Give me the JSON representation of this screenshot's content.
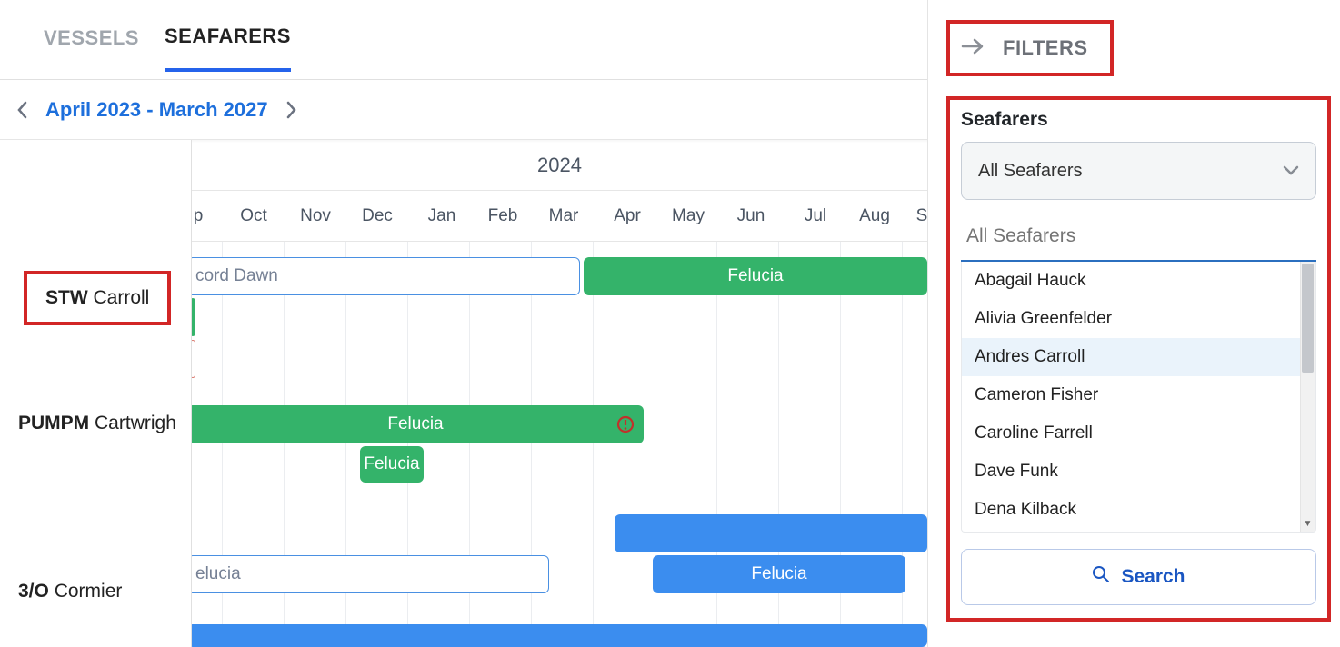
{
  "tabs": {
    "vessels": "VESSELS",
    "seafarers": "SEAFARERS"
  },
  "dateRange": "April 2023 - March 2027",
  "yearLabel": "2024",
  "months": [
    "p",
    "Oct",
    "Nov",
    "Dec",
    "Jan",
    "Feb",
    "Mar",
    "Apr",
    "May",
    "Jun",
    "Jul",
    "Aug",
    "S"
  ],
  "rows": {
    "carroll": {
      "rank": "STW",
      "name": "Carroll"
    },
    "cartwright": {
      "rank": "PUMPM",
      "name": "Cartwrigh"
    },
    "cormier": {
      "rank": "3/O",
      "name": "Cormier"
    }
  },
  "bars": {
    "carroll_cord": "cord Dawn",
    "carroll_felucia": "Felucia",
    "cart_felucia": "Felucia",
    "cart_felucia_chip": "Felucia",
    "cormier_white": "elucia",
    "cormier_blue": "Felucia"
  },
  "panel": {
    "filters": "FILTERS",
    "section": "Seafarers",
    "dropdown": "All Seafarers",
    "placeholder": "All Seafarers",
    "options": [
      "Abagail Hauck",
      "Alivia Greenfelder",
      "Andres Carroll",
      "Cameron Fisher",
      "Caroline Farrell",
      "Dave Funk",
      "Dena Kilback"
    ],
    "searchBtn": "Search"
  }
}
